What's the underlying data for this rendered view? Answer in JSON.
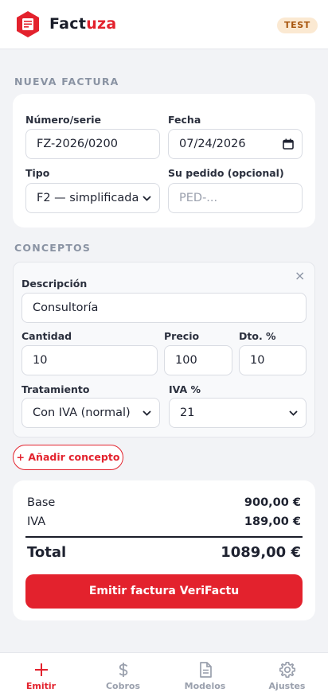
{
  "app": {
    "brand_part1": "Fact",
    "brand_part2": "uza",
    "env_badge": "TEST",
    "accent": "#e3222d"
  },
  "invoice": {
    "section_title": "NUEVA FACTURA",
    "numero_label": "Número/serie",
    "numero_value": "FZ-2026/0200",
    "fecha_label": "Fecha",
    "fecha_value": "07/24/2026",
    "tipo_label": "Tipo",
    "tipo_value": "F2 — simplificada",
    "pedido_label": "Su pedido (opcional)",
    "pedido_placeholder": "PED-..."
  },
  "concepts": {
    "section_title": "CONCEPTOS",
    "items": [
      {
        "descripcion_label": "Descripción",
        "descripcion_value": "Consultoría",
        "cantidad_label": "Cantidad",
        "cantidad_value": "10",
        "precio_label": "Precio",
        "precio_value": "100",
        "dto_label": "Dto. %",
        "dto_value": "10",
        "tratamiento_label": "Tratamiento",
        "tratamiento_value": "Con IVA (normal)",
        "iva_label": "IVA %",
        "iva_value": "21",
        "remove_glyph": "×"
      }
    ],
    "add_label": "+ Añadir concepto"
  },
  "summary": {
    "base_label": "Base",
    "base_value": "900,00 €",
    "iva_label": "IVA",
    "iva_value": "189,00 €",
    "total_label": "Total",
    "total_value": "1089,00 €",
    "emit_label": "Emitir factura VeriFactu"
  },
  "tabs": [
    {
      "label": "Emitir",
      "icon": "plus-icon",
      "active": true
    },
    {
      "label": "Cobros",
      "icon": "dollar-icon",
      "active": false
    },
    {
      "label": "Modelos",
      "icon": "document-icon",
      "active": false
    },
    {
      "label": "Ajustes",
      "icon": "gear-icon",
      "active": false
    }
  ]
}
